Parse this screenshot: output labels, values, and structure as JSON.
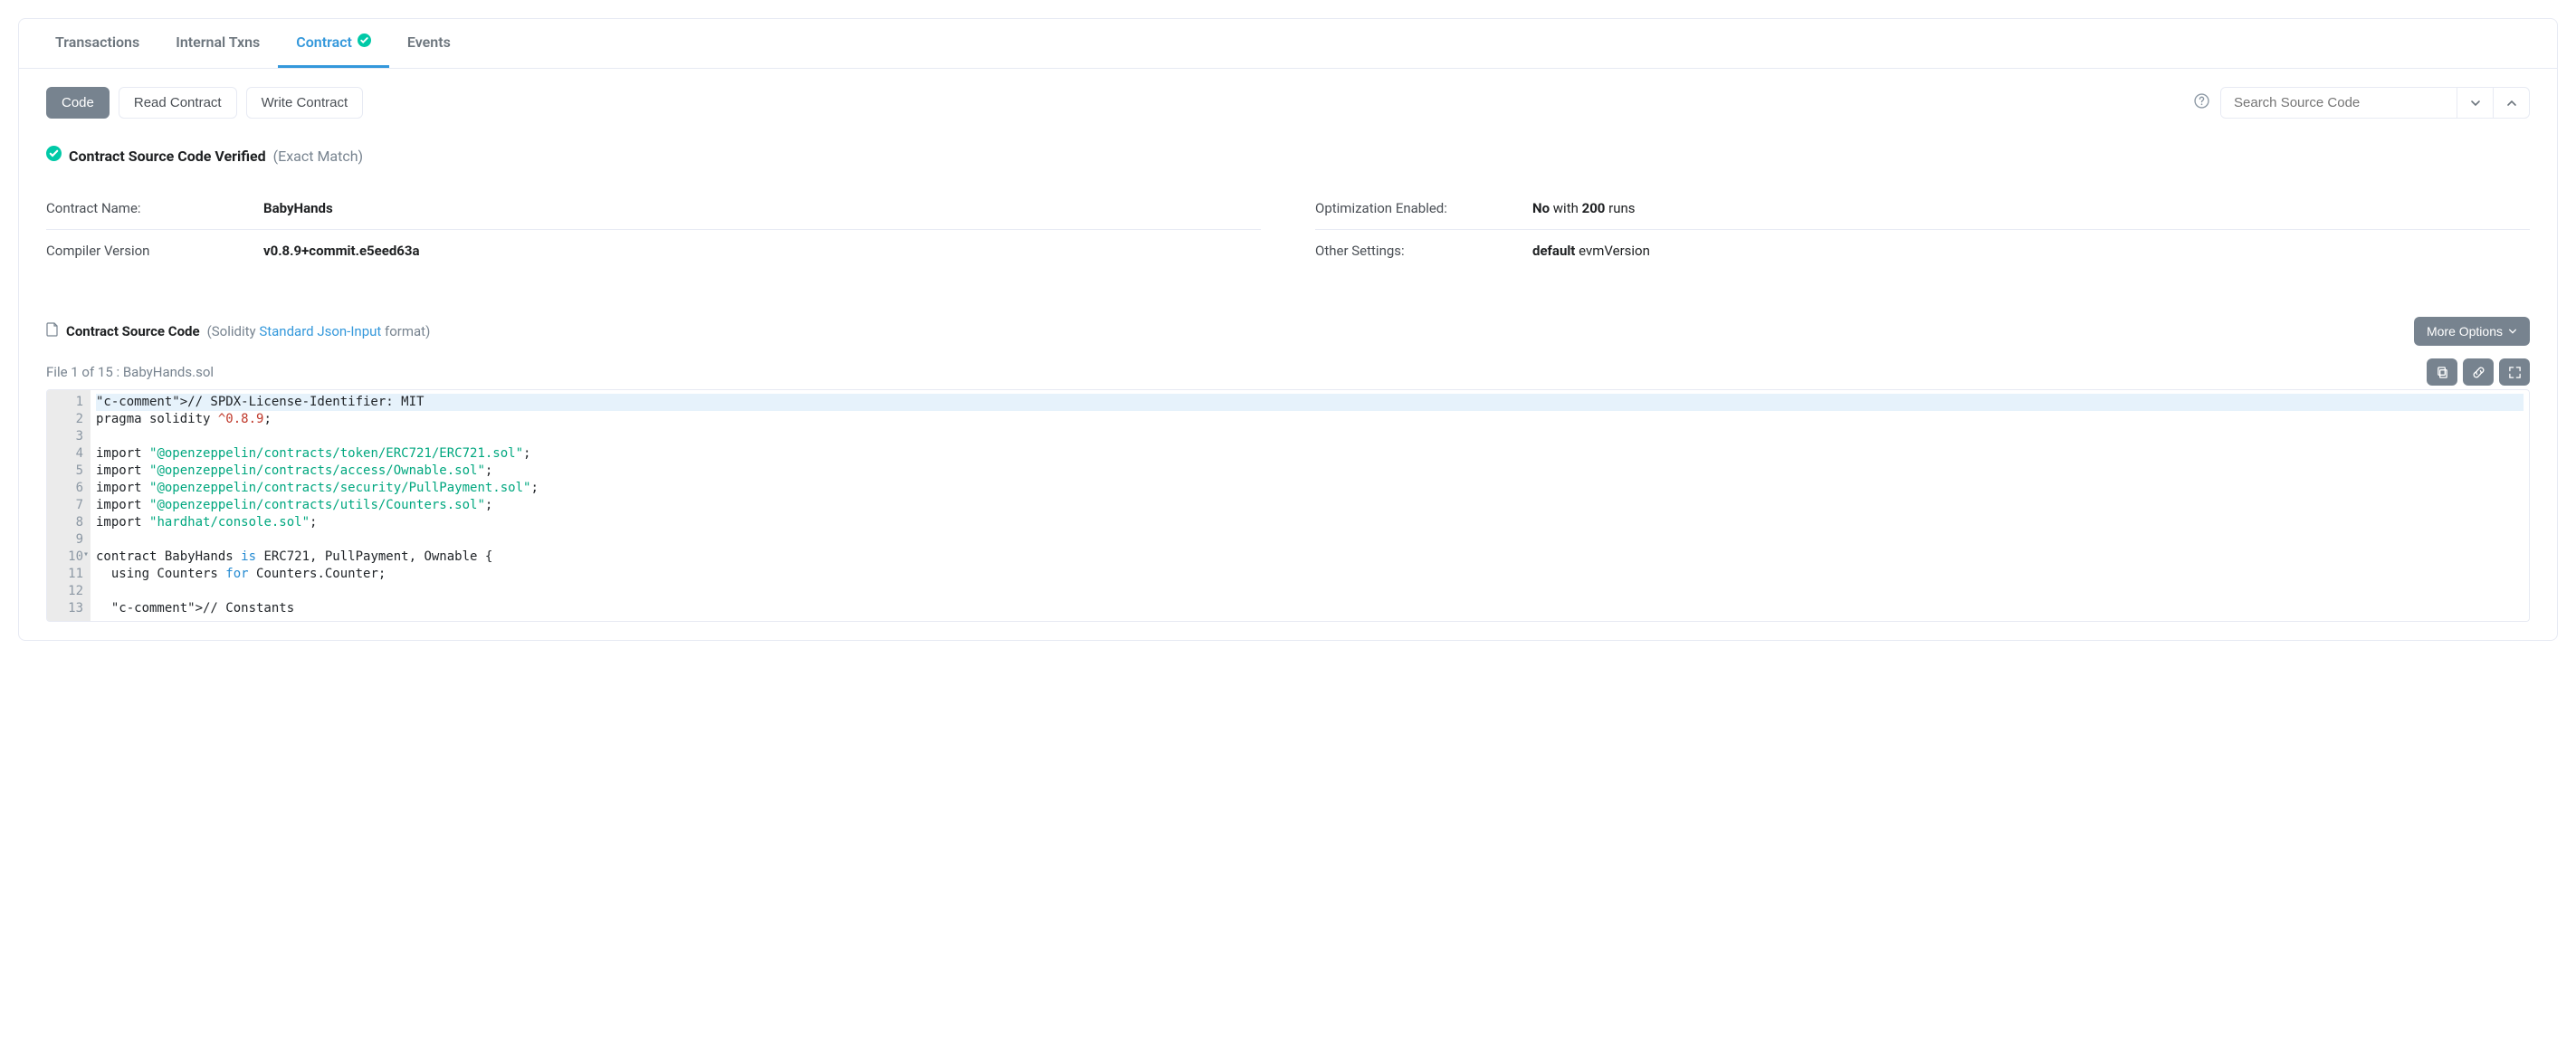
{
  "tabs": {
    "transactions": "Transactions",
    "internal": "Internal Txns",
    "contract": "Contract",
    "events": "Events"
  },
  "subtabs": {
    "code": "Code",
    "read": "Read Contract",
    "write": "Write Contract"
  },
  "search": {
    "placeholder": "Search Source Code"
  },
  "verified": {
    "title": "Contract Source Code Verified",
    "sub": "(Exact Match)"
  },
  "info": {
    "name_label": "Contract Name:",
    "name_value": "BabyHands",
    "compiler_label": "Compiler Version",
    "compiler_value": "v0.8.9+commit.e5eed63a",
    "optim_label": "Optimization Enabled:",
    "optim_bold": "No",
    "optim_mid": " with ",
    "optim_runs": "200",
    "optim_suffix": " runs",
    "other_label": "Other Settings:",
    "other_bold": "default",
    "other_suffix": " evmVersion"
  },
  "source_head": {
    "title": "Contract Source Code",
    "pre": "(Solidity ",
    "link": "Standard Json-Input",
    "post": " format)",
    "more": "More Options"
  },
  "file_info": "File 1 of 15 : BabyHands.sol",
  "code_lines": [
    "// SPDX-License-Identifier: MIT",
    "pragma solidity ^0.8.9;",
    "",
    "import \"@openzeppelin/contracts/token/ERC721/ERC721.sol\";",
    "import \"@openzeppelin/contracts/access/Ownable.sol\";",
    "import \"@openzeppelin/contracts/security/PullPayment.sol\";",
    "import \"@openzeppelin/contracts/utils/Counters.sol\";",
    "import \"hardhat/console.sol\";",
    "",
    "contract BabyHands is ERC721, PullPayment, Ownable {",
    "  using Counters for Counters.Counter;",
    "",
    "  // Constants"
  ]
}
